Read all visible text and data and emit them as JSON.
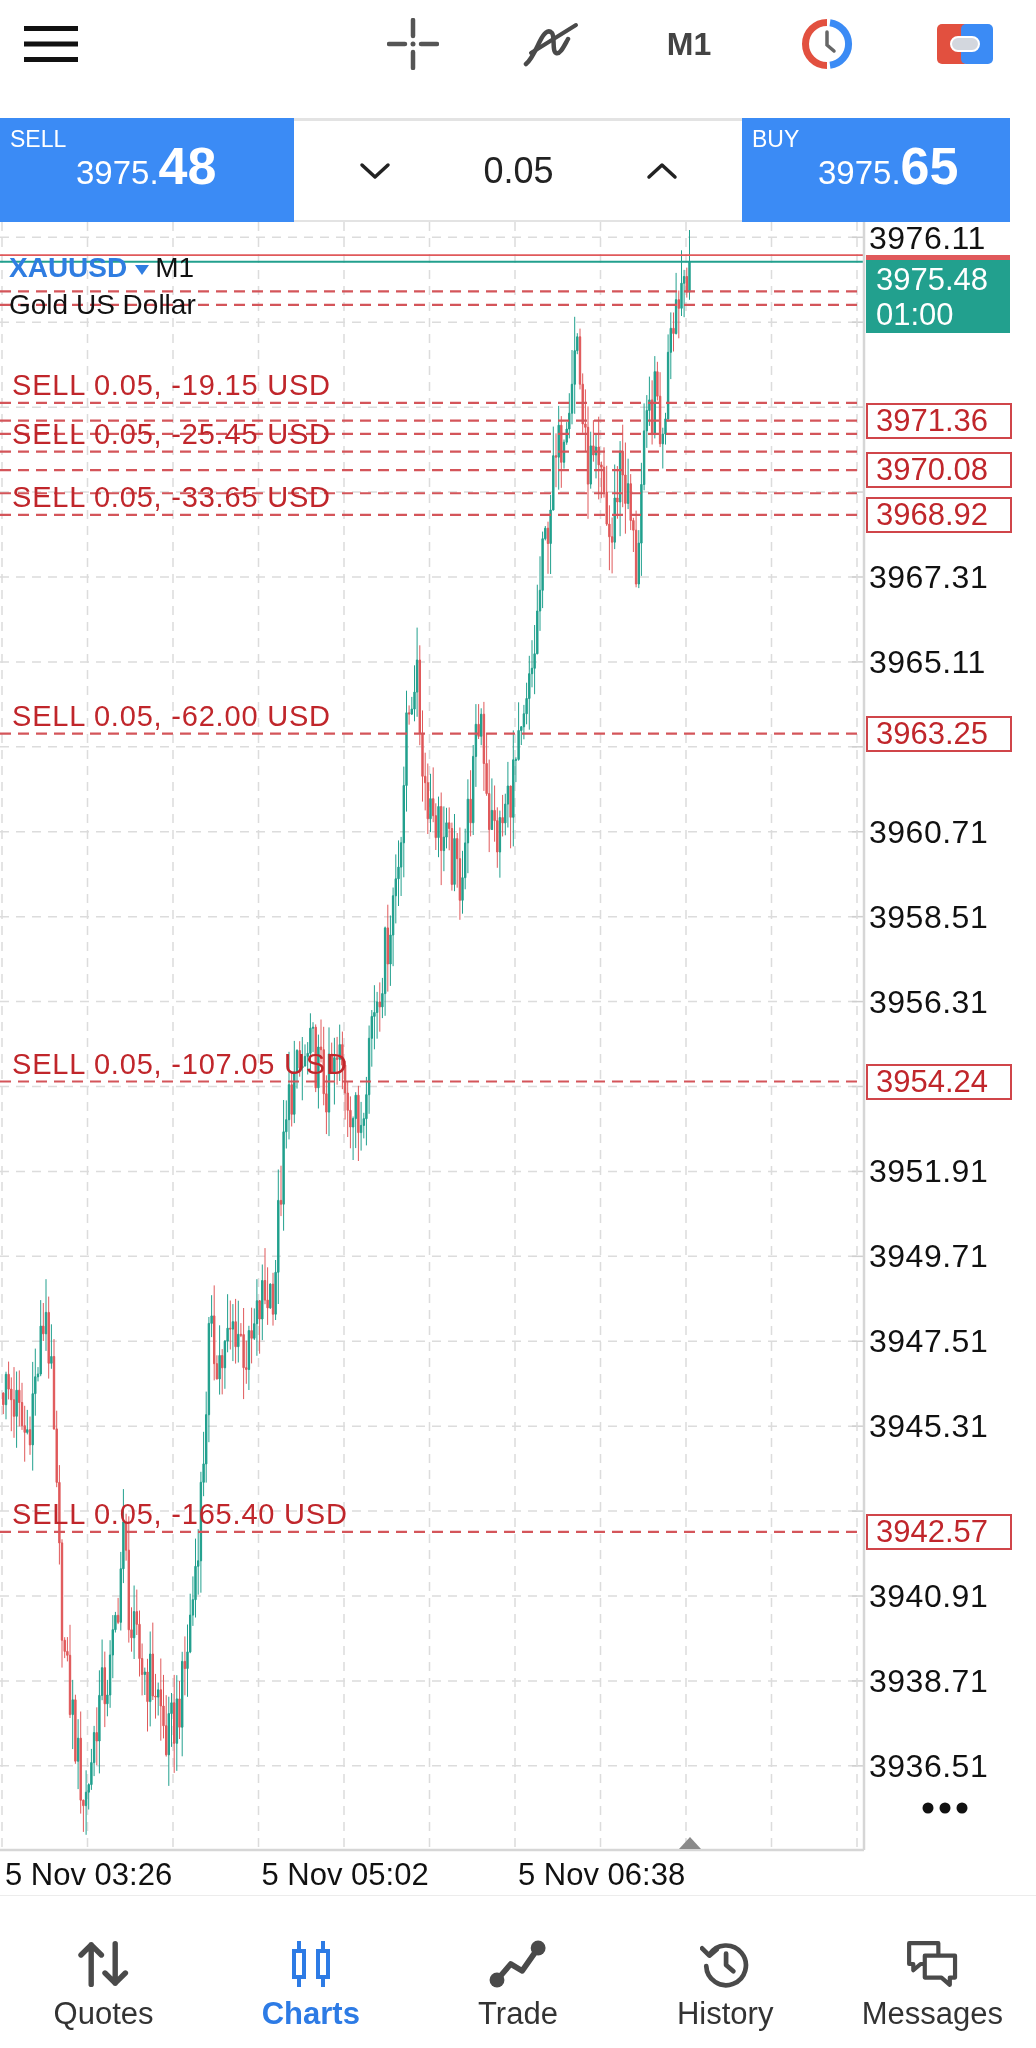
{
  "toolbar": {
    "timeframe": "M1"
  },
  "trade_bar": {
    "sell": {
      "label": "SELL",
      "price": "3975.**48**"
    },
    "volume": {
      "value": "0.05"
    },
    "buy": {
      "label": "BUY",
      "price": "3975.**65**"
    }
  },
  "chart": {
    "symbol": "XAUUSD",
    "timeframe": "M1",
    "description": "Gold US Dollar",
    "order_labels": [
      "SELL 0.05, -19.15 USD",
      "SELL 0.05, -25.45 USD",
      "SELL 0.05, -33.65 USD",
      "SELL 0.05, -62.00 USD",
      "SELL 0.05, -107.05 USD",
      "SELL 0.05, -165.40 USD"
    ],
    "price_axis": [
      "3976.11",
      "3967.31",
      "3965.11",
      "3960.71",
      "3958.51",
      "3956.31",
      "3951.91",
      "3949.71",
      "3947.51",
      "3945.31",
      "3940.91",
      "3938.71",
      "3936.51"
    ],
    "bid_tag": {
      "price": "3975.48",
      "countdown": "01:00"
    },
    "order_price_tags": [
      "3971.36",
      "3970.08",
      "3968.92",
      "3963.25",
      "3954.24",
      "3942.57"
    ],
    "time_axis": [
      "5 Nov 03:26",
      "5 Nov 05:02",
      "5 Nov 06:38"
    ]
  },
  "nav": [
    {
      "label": "Quotes",
      "selected": false
    },
    {
      "label": "Charts",
      "selected": true
    },
    {
      "label": "Trade",
      "selected": false
    },
    {
      "label": "History",
      "selected": false
    },
    {
      "label": "Messages",
      "selected": false
    }
  ]
}
